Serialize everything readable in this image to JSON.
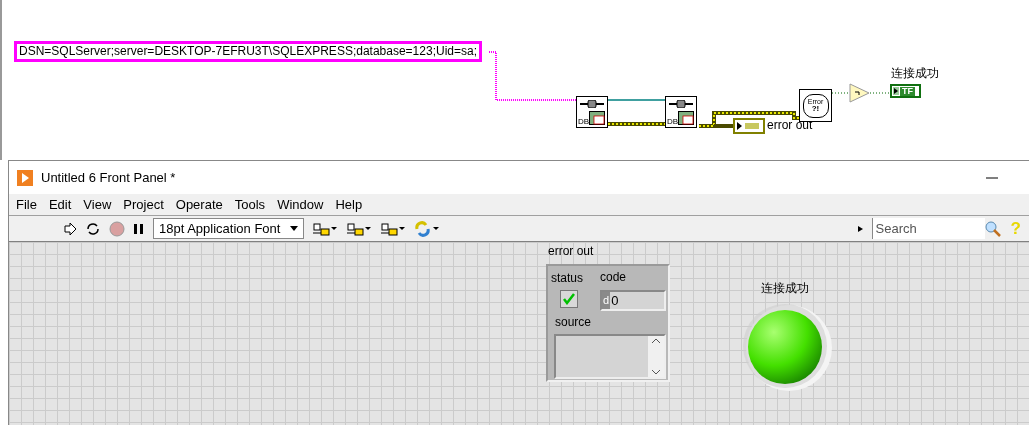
{
  "block_diagram": {
    "string_constant": "DSN=SQLServer;server=DESKTOP-7EFRU3T\\SQLEXPRESS;database=123;Uid=sa;",
    "db_nodes": [
      {
        "label": "DB"
      },
      {
        "label": "DB"
      }
    ],
    "error_terminal": {
      "label": "error out"
    },
    "error_dialog": {
      "text": "Error",
      "mark": "?!"
    },
    "boolean_terminal": {
      "label": "连接成功",
      "text": "TF"
    }
  },
  "window": {
    "title": "Untitled 6 Front Panel *",
    "menu": [
      "File",
      "Edit",
      "View",
      "Project",
      "Operate",
      "Tools",
      "Window",
      "Help"
    ],
    "font_dropdown": "18pt Application Font",
    "search": {
      "placeholder": "Search"
    },
    "help": "?"
  },
  "front_panel": {
    "error_cluster": {
      "label": "error out",
      "status_label": "status",
      "status_checked": true,
      "code_label": "code",
      "code_radix": "d",
      "code_value": "0",
      "source_label": "source"
    },
    "led": {
      "label": "连接成功",
      "on": true
    }
  }
}
